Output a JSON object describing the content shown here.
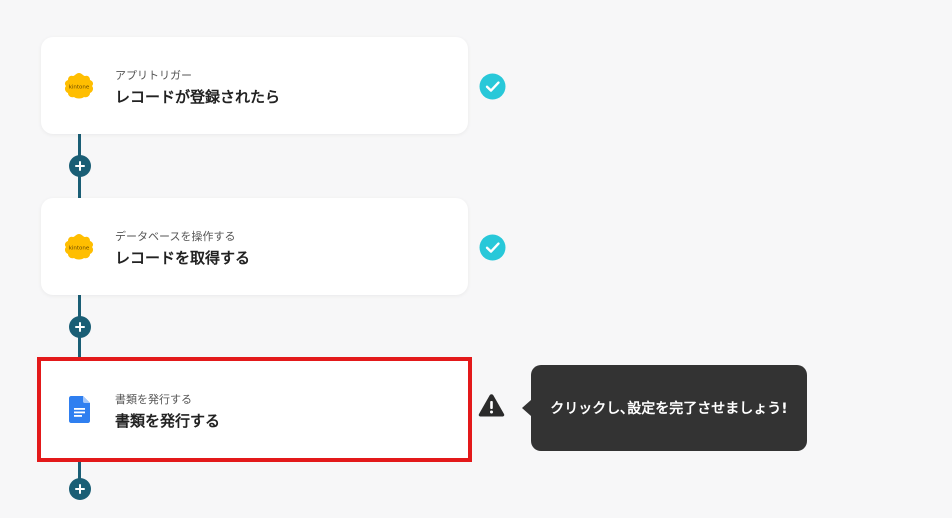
{
  "flow": {
    "steps": [
      {
        "sub_label": "アプリトリガー",
        "main_label": "レコードが登録されたら",
        "icon": "kintone-logo-icon",
        "status": "complete"
      },
      {
        "sub_label": "データベースを操作する",
        "main_label": "レコードを取得する",
        "icon": "kintone-logo-icon",
        "status": "complete"
      },
      {
        "sub_label": "書類を発行する",
        "main_label": "書類を発行する",
        "icon": "google-docs-icon",
        "status": "warning"
      }
    ],
    "logo_text": "kintone"
  },
  "tooltip": {
    "text": "クリックし､設定を完了させましょう!"
  },
  "colors": {
    "connector": "#1a5e75",
    "check": "#28c8d9",
    "highlight": "#e3191a",
    "tooltip_bg": "#333333",
    "kintone": "#ffbe00",
    "docs_blue": "#2f7ff0"
  }
}
